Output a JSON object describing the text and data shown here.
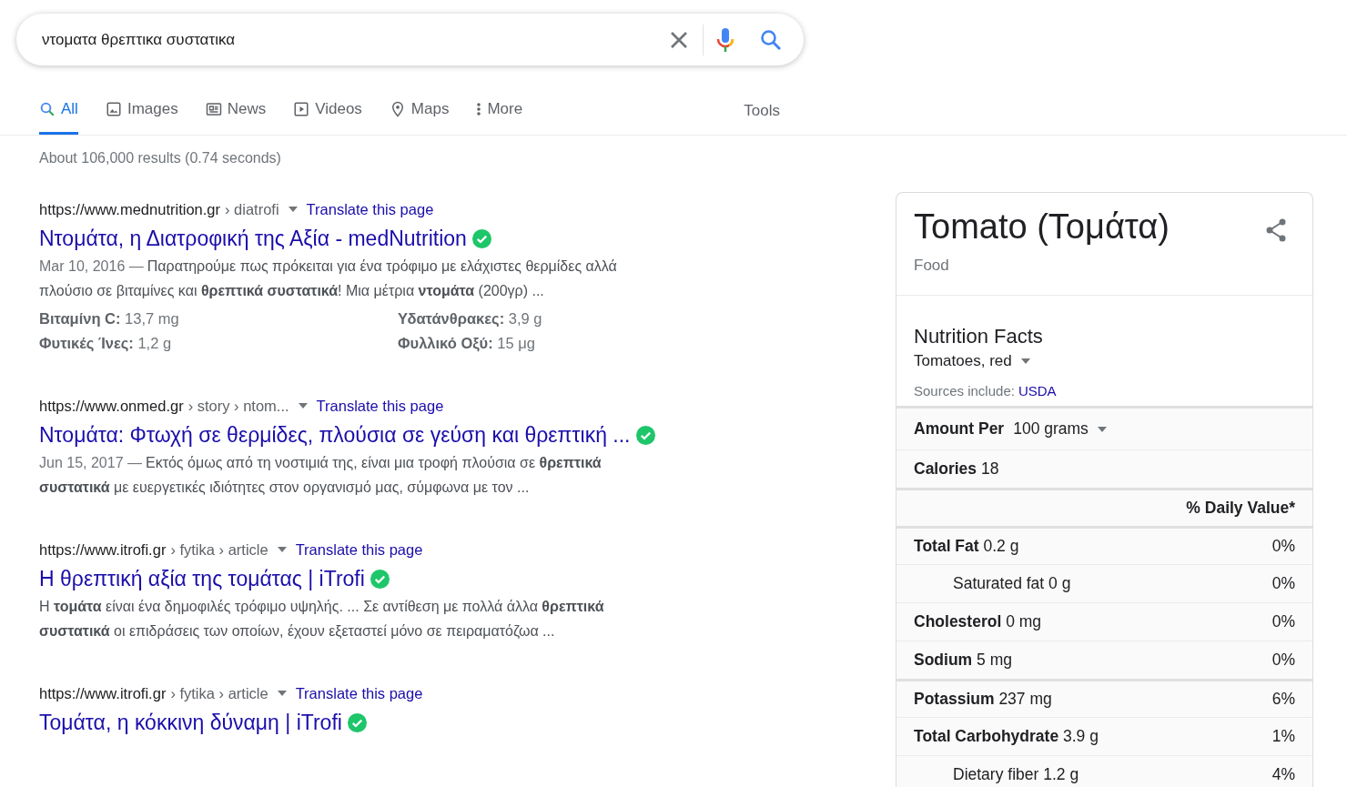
{
  "search": {
    "value": "ντοματα θρεπτικα συστατικα"
  },
  "tabs": [
    {
      "label": "All",
      "kind": "search",
      "selected": true
    },
    {
      "label": "Images",
      "kind": "image",
      "selected": false
    },
    {
      "label": "News",
      "kind": "news",
      "selected": false
    },
    {
      "label": "Videos",
      "kind": "video",
      "selected": false
    },
    {
      "label": "Maps",
      "kind": "pin",
      "selected": false
    },
    {
      "label": "More",
      "kind": "dots",
      "selected": false
    }
  ],
  "tools": "Tools",
  "result_stats": "About 106,000 results (0.74 seconds)",
  "results": [
    {
      "site": "https://www.mednutrition.gr",
      "path": "› diatrofi",
      "translate": "Translate this page",
      "title": "Ντομάτα, η Διατροφική της Αξία - medNutrition",
      "verified": true,
      "date": "Mar 10, 2016 —",
      "snippet": "Παρατηρούμε πως πρόκειται για ένα τρόφιμο με ελάχιστες θερμίδες αλλά πλούσιο σε βιταμίνες και **θρεπτικά συστατικά**! Μια μέτρια **ντομάτα** (200γρ) ...",
      "facts": [
        "**Βιταμίνη C:** 13,7 mg",
        "**Υδατάνθρακες:** 3,9 g",
        "**Φυτικές Ίνες:** 1,2 g",
        "**Φυλλικό Οξύ:** 15 μg"
      ]
    },
    {
      "site": "https://www.onmed.gr",
      "path": "› story › ntom...",
      "translate": "Translate this page",
      "title": "Ντομάτα: Φτωχή σε θερμίδες, πλούσια σε γεύση και θρεπτική ...",
      "verified": true,
      "date": "Jun 15, 2017 —",
      "snippet": "Εκτός όμως από τη νοστιμιά της, είναι μια τροφή πλούσια σε **θρεπτικά συστατικά** με ευεργετικές ιδιότητες στον οργανισμό μας, σύμφωνα με τον ..."
    },
    {
      "site": "https://www.itrofi.gr",
      "path": "› fytika › article",
      "translate": "Translate this page",
      "title": "Η θρεπτική αξία της τομάτας | iTrofi",
      "verified": true,
      "snippet": "Η **τομάτα** είναι ένα δημοφιλές τρόφιμο υψηλής. ... Σε αντίθεση με πολλά άλλα **θρεπτικά συστατικά** οι επιδράσεις των οποίων, έχουν εξεταστεί μόνο σε πειραματόζωα ..."
    },
    {
      "site": "https://www.itrofi.gr",
      "path": "› fytika › article",
      "translate": "Translate this page",
      "title": "Τομάτα, η κόκκινη δύναμη | iTrofi",
      "verified": true
    }
  ],
  "panel": {
    "title": "Tomato (Τομάτα)",
    "subtitle": "Food",
    "nutrition_title": "Nutrition Facts",
    "variety": "Tomatoes, red",
    "sources_label": "Sources include:",
    "sources_link": "USDA",
    "amount_label": "Amount Per",
    "amount_value": "100 grams",
    "calories_label": "Calories",
    "calories_value": "18",
    "daily_value_header": "% Daily Value*",
    "rows": [
      {
        "kind": "main",
        "name": "Total Fat",
        "amount": "0.2 g",
        "percent": "0%",
        "group_start": true
      },
      {
        "kind": "sub",
        "name": "Saturated fat",
        "amount": "0 g",
        "percent": "0%",
        "group_start": false
      },
      {
        "kind": "main",
        "name": "Cholesterol",
        "amount": "0 mg",
        "percent": "0%",
        "group_start": false
      },
      {
        "kind": "main",
        "name": "Sodium",
        "amount": "5 mg",
        "percent": "0%",
        "group_start": false
      },
      {
        "kind": "main",
        "name": "Potassium",
        "amount": "237 mg",
        "percent": "6%",
        "group_start": true
      },
      {
        "kind": "main",
        "name": "Total Carbohydrate",
        "amount": "3.9 g",
        "percent": "1%",
        "group_start": false
      },
      {
        "kind": "sub",
        "name": "Dietary fiber",
        "amount": "1.2 g",
        "percent": "4%",
        "group_start": false
      }
    ]
  }
}
